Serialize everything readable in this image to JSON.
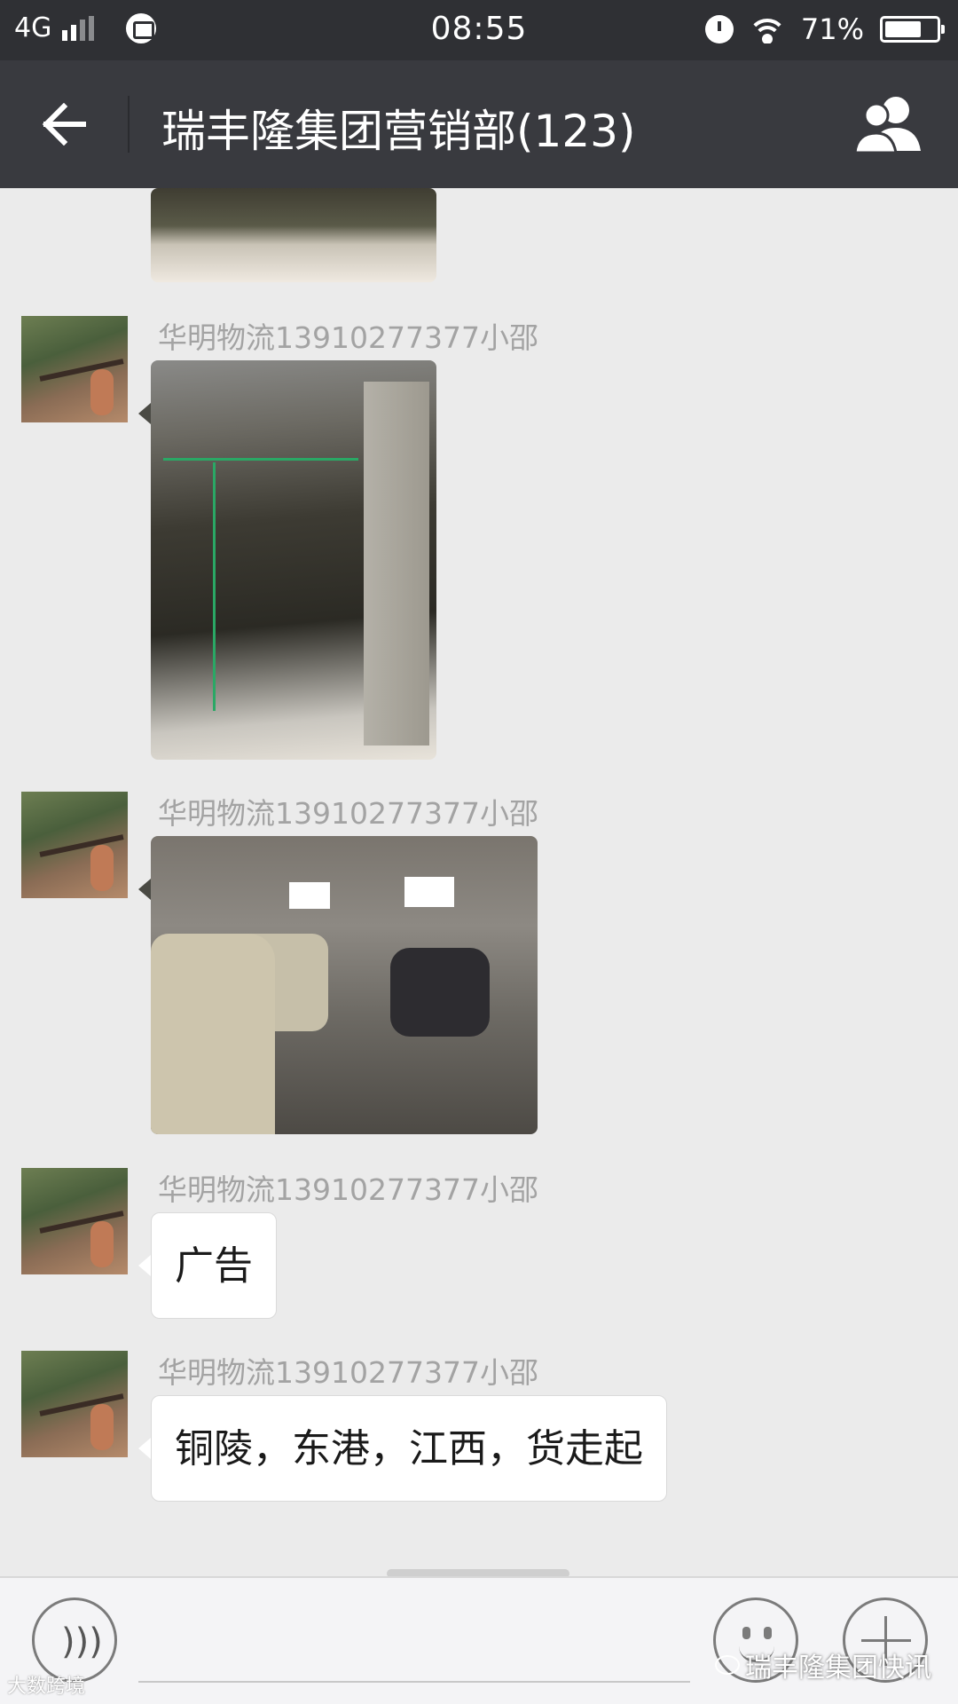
{
  "status_bar": {
    "network": "4G",
    "time": "08:55",
    "battery_percent": "71%",
    "battery_level": 0.71,
    "icons": [
      "signal-icon",
      "message-icon",
      "alarm-icon",
      "wifi-icon",
      "battery-icon"
    ]
  },
  "header": {
    "title": "瑞丰隆集团营销部(123)",
    "back_icon": "arrow-left-icon",
    "members_icon": "group-members-icon"
  },
  "messages": [
    {
      "type": "image",
      "sender": "",
      "image": "truck-loading-photo-partial"
    },
    {
      "type": "image",
      "sender": "华明物流13910277377小邵",
      "image": "truck-loading-photo"
    },
    {
      "type": "image",
      "sender": "华明物流13910277377小邵",
      "image": "warehouse-cars-photo"
    },
    {
      "type": "text",
      "sender": "华明物流13910277377小邵",
      "text": "广告"
    },
    {
      "type": "text",
      "sender": "华明物流13910277377小邵",
      "text": "铜陵，东港，江西，货走起"
    }
  ],
  "input_bar": {
    "voice_icon": "voice-icon",
    "emoji_icon": "emoji-icon",
    "plus_icon": "plus-icon"
  },
  "watermarks": {
    "left": "大数跨境",
    "right": "瑞丰隆集团快讯"
  },
  "colors": {
    "status_bar_bg": "#2f3034",
    "title_bar_bg": "#393a3f",
    "chat_bg": "#ebebeb",
    "sender_text": "#a3a3a3",
    "bubble_bg": "#ffffff",
    "input_bar_bg": "#f4f4f6"
  }
}
